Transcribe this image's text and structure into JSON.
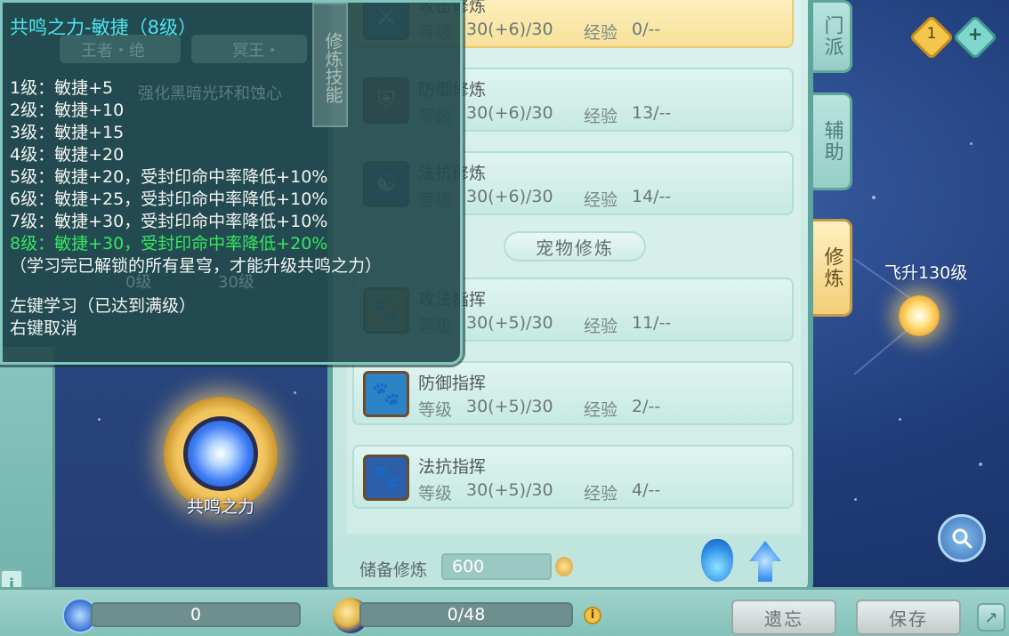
{
  "tooltip": {
    "title": "共鸣之力-敏捷（8级）",
    "levels": [
      "1级：敏捷+5",
      "2级：敏捷+10",
      "3级：敏捷+15",
      "4级：敏捷+20",
      "5级：敏捷+20，受封印命中率降低+10%",
      "6级：敏捷+25，受封印命中率降低+10%",
      "7级：敏捷+30，受封印命中率降低+10%",
      "8级：敏捷+30，受封印命中率降低+20%"
    ],
    "active_level_index": 7,
    "note": "（学习完已解锁的所有星穹，才能升级共鸣之力）",
    "hint_left": "左键学习（已达到满级）",
    "hint_right": "右键取消"
  },
  "background_left": {
    "tag_1": "王者・绝",
    "tag_2": "冥王・",
    "desc": "强化黑暗光环和蚀心",
    "num_a": "0级",
    "num_b": "30级",
    "skill_tab": "修炼技能"
  },
  "resonance": {
    "label": "共鸣之力"
  },
  "cultivation": {
    "top_cards": [
      {
        "name": "攻击修炼",
        "level_label": "等级",
        "level": "30(+6)/30",
        "exp_label": "经验",
        "exp": "0/--",
        "icon": "sword-shield-icon",
        "highlight": true
      },
      {
        "name": "防御修炼",
        "level_label": "等级",
        "level": "30(+6)/30",
        "exp_label": "经验",
        "exp": "13/--",
        "icon": "shield-icon",
        "highlight": false
      },
      {
        "name": "法抗修炼",
        "level_label": "等级",
        "level": "30(+6)/30",
        "exp_label": "经验",
        "exp": "14/--",
        "icon": "yin-yang-shield-icon",
        "highlight": false
      }
    ],
    "pet_section_title": "宠物修炼",
    "pet_cards": [
      {
        "name": "攻法指挥",
        "level_label": "等级",
        "level": "30(+5)/30",
        "exp_label": "经验",
        "exp": "11/--",
        "icon": "paw-sword-icon"
      },
      {
        "name": "防御指挥",
        "level_label": "等级",
        "level": "30(+5)/30",
        "exp_label": "经验",
        "exp": "2/--",
        "icon": "paw-shield-icon"
      },
      {
        "name": "法抗指挥",
        "level_label": "等级",
        "level": "30(+5)/30",
        "exp_label": "经验",
        "exp": "4/--",
        "icon": "paw-magic-icon"
      }
    ],
    "reserve_label": "储备修炼",
    "reserve_value": "600"
  },
  "right_tabs": [
    {
      "label": "门派",
      "active": false
    },
    {
      "label": "辅助",
      "active": false
    },
    {
      "label": "修炼",
      "active": true
    }
  ],
  "right_area": {
    "fly_label": "飞升130级",
    "badge_count": "1",
    "plus_label": "+"
  },
  "bottom": {
    "left_value": "0",
    "middle_value": "0/48",
    "middle_progress": 0,
    "forget_button": "遗忘",
    "save_button": "保存"
  },
  "colors": {
    "tooltip_title": "#4de4ec",
    "active_level": "#34e860",
    "panel_bg": "#d3efea",
    "highlight_card": "#f7e19a"
  }
}
